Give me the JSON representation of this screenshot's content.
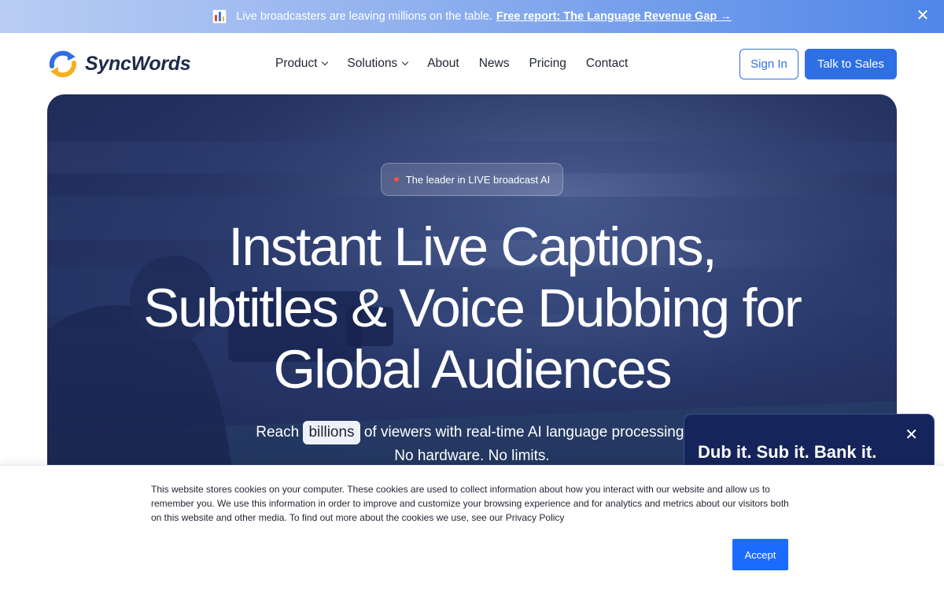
{
  "announcement": {
    "text": "Live broadcasters are leaving millions on the table.",
    "link": "Free report: The Language Revenue Gap →",
    "close": "✕"
  },
  "nav": {
    "logo_text": "SyncWords",
    "menu": [
      {
        "label": "Product"
      },
      {
        "label": "Solutions"
      },
      {
        "label": "About"
      },
      {
        "label": "News"
      },
      {
        "label": "Pricing"
      },
      {
        "label": "Contact"
      }
    ],
    "sign_in": "Sign In",
    "talk_to_sales": "Talk to Sales"
  },
  "hero": {
    "badge": "The leader in LIVE broadcast AI",
    "headline_line1": "Instant Live Captions,",
    "headline_line2": "Subtitles & Voice Dubbing for",
    "headline_line3": "Global Audiences",
    "sub_pre": "Reach",
    "sub_highlight": "billions",
    "sub_post": "of viewers with real-time AI language processing.",
    "sub_line2": "No hardware. No limits."
  },
  "widget": {
    "title": "Dub it. Sub it. Bank it.",
    "close": "✕"
  },
  "cookie": {
    "text": "This website stores cookies on your computer. These cookies are used to collect information about how you interact with our website and allow us to remember you. We use this information in order to improve and customize your browsing experience and for analytics and metrics about our visitors both on this website and other media. To find out more about the cookies we use, see our Privacy Policy",
    "accept": "Accept"
  },
  "colors": {
    "accent": "#2f6fe4",
    "hero_bg": "#2a3a6d",
    "widget_bg": "#15245a",
    "cookie_accept": "#1b6bff"
  }
}
